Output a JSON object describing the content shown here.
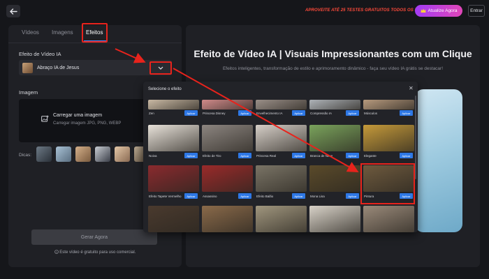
{
  "header": {
    "promo_text": "APROVEITE ATÉ 25 TESTES GRATUITOS TODOS OS DIAS!",
    "upgrade_label": "Atualize Agora",
    "login_label": "Entrar"
  },
  "tabs": [
    {
      "label": "Vídeos"
    },
    {
      "label": "Imagens"
    },
    {
      "label": "Efeitos",
      "active": true
    }
  ],
  "effect_section": {
    "label": "Efeito de Vídeo IA",
    "selected_value": "Abraço IA de Jesus"
  },
  "image_section": {
    "label": "Imagem",
    "upload_title": "Carregar uma imagem",
    "upload_formats": "Carregar imagem JPG, PNG, WEBP"
  },
  "tips": {
    "label": "Dicas:"
  },
  "generate": {
    "button_label": "Gerar Agora",
    "note": "Este vídeo é gratuito para uso comercial."
  },
  "hero": {
    "title": "Efeito de Vídeo IA | Visuais Impressionantes com um Clique",
    "subtitle": "Efeitos inteligentes, transformação de estilo e aprimoramento dinâmico - faça seu vídeo IA grátis se destacar!"
  },
  "modal": {
    "title": "Selecione o efeito",
    "apply_label": "Aplicar",
    "effects_row1": [
      {
        "name": "Zen",
        "color": "#c9b9a4"
      },
      {
        "name": "Princesa Disney",
        "color": "#d08a8a"
      },
      {
        "name": "Envelhecimento IA",
        "color": "#9a8f88"
      },
      {
        "name": "Compressão IA",
        "color": "#aeb3b8"
      },
      {
        "name": "Músculos",
        "color": "#b79a7e"
      }
    ],
    "effects_row2": [
      {
        "name": "Noiva",
        "color": "#e8e2da"
      },
      {
        "name": "Efeito de Tiro",
        "color": "#8c8580"
      },
      {
        "name": "Princesa Real",
        "color": "#d6cfc8"
      },
      {
        "name": "Branca de Neve",
        "color": "#7aa35c"
      },
      {
        "name": "Elegante",
        "color": "#c59a3a"
      }
    ],
    "effects_row3": [
      {
        "name": "Efeito Tapete Vermelho",
        "color": "#8a2a2e"
      },
      {
        "name": "Assassino",
        "color": "#9a2a2a"
      },
      {
        "name": "Efeito Balão",
        "color": "#7a7466"
      },
      {
        "name": "Mona Lisa",
        "color": "#5a4a2a"
      },
      {
        "name": "Pintura",
        "color": "#6e5a3e",
        "selected": true
      }
    ],
    "effects_row4": [
      {
        "name": "",
        "color": "#4a3a2e"
      },
      {
        "name": "",
        "color": "#8a6a4a"
      },
      {
        "name": "",
        "color": "#a0967e"
      },
      {
        "name": "",
        "color": "#d8d2c8"
      },
      {
        "name": "",
        "color": "#9a8a7a"
      }
    ]
  },
  "colors": {
    "accent_red": "#e8231c",
    "apply_blue": "#2e78e6",
    "upgrade_gradient_start": "#a23bf5",
    "upgrade_gradient_end": "#e046b8",
    "promo_red": "#ff4a3a"
  },
  "icons": {
    "back": "arrow-left-icon",
    "crown": "crown-icon",
    "chevron": "chevron-down-icon",
    "upload": "image-upload-icon",
    "close": "close-icon",
    "info": "info-icon"
  }
}
